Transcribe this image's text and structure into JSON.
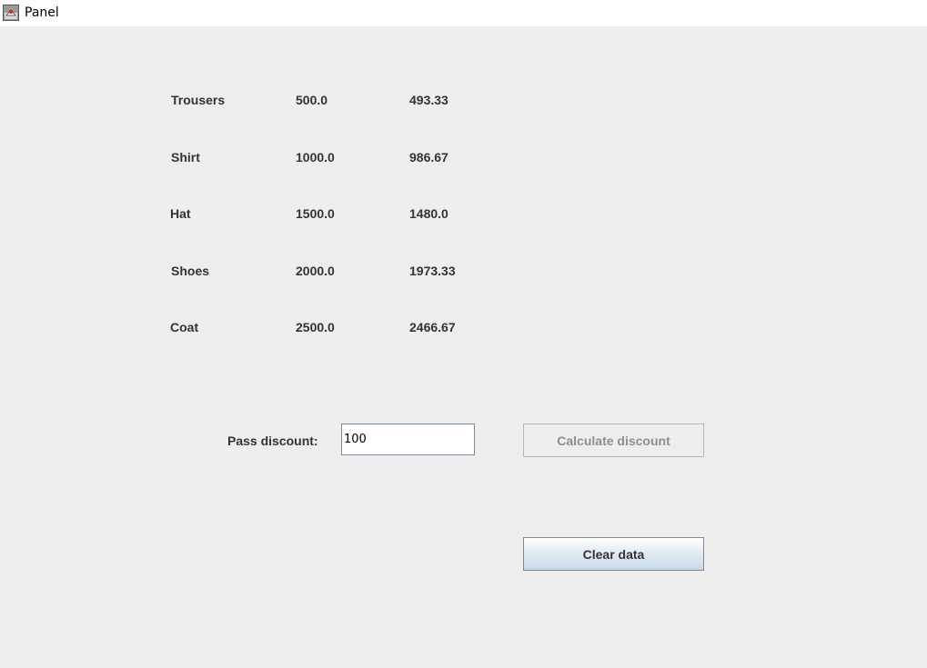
{
  "window": {
    "title": "Panel",
    "icon": "java-app-icon"
  },
  "products": [
    {
      "name": "Trousers",
      "price": "500.0",
      "discounted": "493.33"
    },
    {
      "name": "Shirt",
      "price": "1000.0",
      "discounted": "986.67"
    },
    {
      "name": "Hat",
      "price": "1500.0",
      "discounted": "1480.0"
    },
    {
      "name": "Shoes",
      "price": "2000.0",
      "discounted": "1973.33"
    },
    {
      "name": "Coat",
      "price": "2500.0",
      "discounted": "2466.67"
    }
  ],
  "discount": {
    "label": "Pass discount:",
    "value": "100"
  },
  "buttons": {
    "calculate": "Calculate discount",
    "calculate_enabled": false,
    "clear": "Clear data"
  }
}
